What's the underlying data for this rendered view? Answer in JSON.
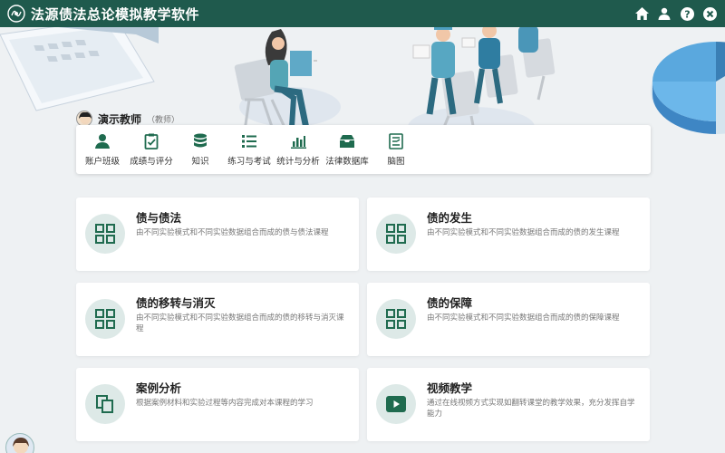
{
  "app": {
    "title": "法源债法总论模拟教学软件"
  },
  "window_icons": [
    "home-icon",
    "user-icon",
    "help-icon",
    "close-icon"
  ],
  "user": {
    "name": "演示教师",
    "role": "（教师）"
  },
  "nav": [
    {
      "label": "账户班级",
      "icon": "account-class-icon"
    },
    {
      "label": "成绩与评分",
      "icon": "grade-clipboard-icon"
    },
    {
      "label": "知识",
      "icon": "knowledge-database-icon"
    },
    {
      "label": "练习与考试",
      "icon": "exercise-list-icon"
    },
    {
      "label": "统计与分析",
      "icon": "statistics-bar-icon"
    },
    {
      "label": "法律数据库",
      "icon": "law-database-icon"
    },
    {
      "label": "脑图",
      "icon": "mindmap-icon"
    }
  ],
  "cards": [
    {
      "title": "债与债法",
      "desc": "由不同实验模式和不同实验数据组合而成的债与债法课程",
      "icon": "grid-icon"
    },
    {
      "title": "债的发生",
      "desc": "由不同实验模式和不同实验数据组合而成的债的发生课程",
      "icon": "grid-icon"
    },
    {
      "title": "债的移转与消灭",
      "desc": "由不同实验模式和不同实验数据组合而成的债的移转与消灭课程",
      "icon": "grid-icon"
    },
    {
      "title": "债的保障",
      "desc": "由不同实验模式和不同实验数据组合而成的债的保障课程",
      "icon": "grid-icon"
    },
    {
      "title": "案例分析",
      "desc": "根据案例材料和实验过程等内容完成对本课程的学习",
      "icon": "copy-documents-icon"
    },
    {
      "title": "视频教学",
      "desc": "通过在线视频方式实现如翻转课堂的教学效果，充分发挥自学能力",
      "icon": "video-play-icon"
    }
  ],
  "colors": {
    "titlebar": "#1f5a4d",
    "accent": "#1f6b4f",
    "card_icon_bg": "#dde9e7",
    "background": "#eef1f3"
  }
}
